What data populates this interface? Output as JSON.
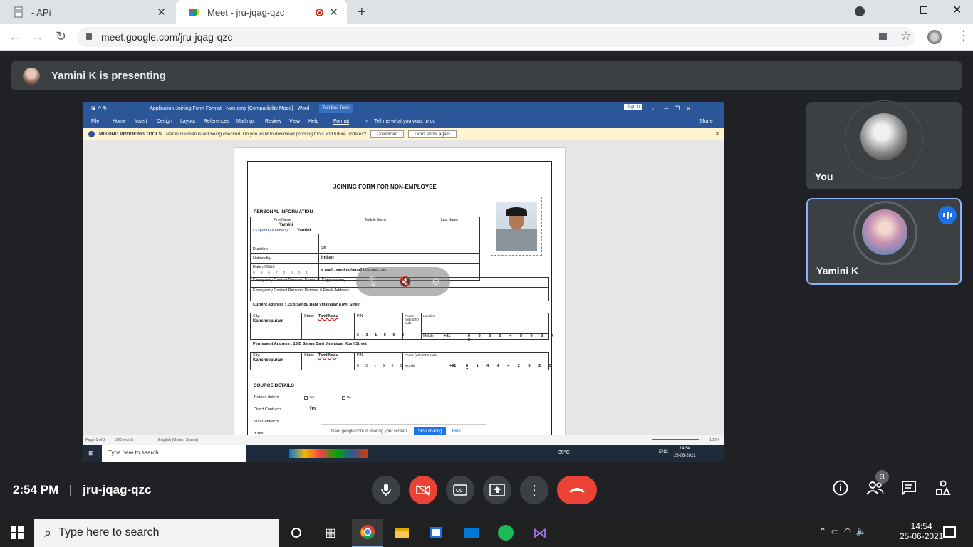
{
  "browser": {
    "tabs": [
      {
        "title": "- APi",
        "close": "✕"
      },
      {
        "title": "Meet - jru-jqag-qzc",
        "close": "✕"
      }
    ],
    "new_tab": "+",
    "url": "meet.google.com/jru-jqag-qzc"
  },
  "meet": {
    "presenting": "Yamini K is presenting",
    "participants": [
      {
        "name": "You"
      },
      {
        "name": "Yamini K"
      }
    ],
    "time": "2:54 PM",
    "separator": "|",
    "meeting_code": "jru-jqag-qzc",
    "participant_count": "3",
    "colors": {
      "bg": "#202124",
      "tile": "#3c4043",
      "end_call": "#ea4335",
      "accent": "#1a73e8"
    }
  },
  "word": {
    "title": "Application Joining Form Format - Non-emp [Compatibility Mode] - Word",
    "context_tab": "Text Box Tools",
    "sign_in": "Sign in",
    "menu": [
      "File",
      "Home",
      "Insert",
      "Design",
      "Layout",
      "References",
      "Mailings",
      "Review",
      "View",
      "Help",
      "Format"
    ],
    "tell_me": "Tell me what you want to do",
    "share": "Share",
    "warning_title": "MISSING PROOFING TOOLS",
    "warning_text": "Text in German is not being checked. Do you want to download proofing tools and future updates?",
    "download": "Download",
    "dont_show": "Don't show again",
    "status_page": "Page 1 of 2",
    "status_words": "393 words",
    "status_lang": "English (United States)",
    "zoom": "100%",
    "sharing_note": "meet.google.com is sharing your screen.",
    "stop_sharing": "Stop sharing",
    "hide": "Hide"
  },
  "form": {
    "title": "JOINING FORM FOR NON-EMPLOYEE",
    "personal_info": "PERSONAL INFORMATION",
    "first_name": "First Name",
    "middle_name": "Middle Name",
    "last_name": "Last Name",
    "expand_names": "( Expand all names) :",
    "name_value": "Yamini",
    "duration_label": "Duration",
    "duration_value": "20",
    "nationality_label": "Nationality",
    "nationality_value": "Indian",
    "dob_label": "Date of Birth",
    "dob_digits": "0 3 0 7 2 0 0 1",
    "email": "e mail : yaminidhanu03@gmail.com",
    "emergency_name": "Emergency Contact Person's Name: B. Kuppaswamy",
    "emergency_number": "Emergency Contact Person's Number & Email-Address:",
    "current_address": "Current Address :  15/B Sangu Bani Vinayagar Kovil Street",
    "city_label": "City:",
    "city_value": "Kancheepuram",
    "state_label": "State:",
    "state_value": "TamilNadu",
    "pin_label": "PIN",
    "pin_digits": "6 3 1 5 0 2",
    "phone_label": "Phone (with STD code)",
    "landline_label": "Landline",
    "mobile_label": "Mobile",
    "code": "+91",
    "mobile1": "6 3 6 9 4 5 0 8 7 5",
    "permanent_address": "Permanent Address :  15/B Sangu Bani Vinayagar Kovil Street",
    "mobile2": "8 1 4 4 4 2 8 2 5 7",
    "source_details": "SOURCE DETAILS",
    "trainee": "Trainee /Intern",
    "yes": "Yes",
    "no": "No",
    "direct": "Direct Contracts",
    "direct_value": "Yes",
    "sub": "Sub-Contracts",
    "if_yes": "If Yes,"
  },
  "inner_taskbar": {
    "search": "Type here to search",
    "weather": "35°C",
    "lang": "ENG",
    "time": "14:54",
    "date": "25-06-2021"
  },
  "taskbar": {
    "search": "Type here to search",
    "time": "14:54",
    "date": "25-06-2021"
  }
}
